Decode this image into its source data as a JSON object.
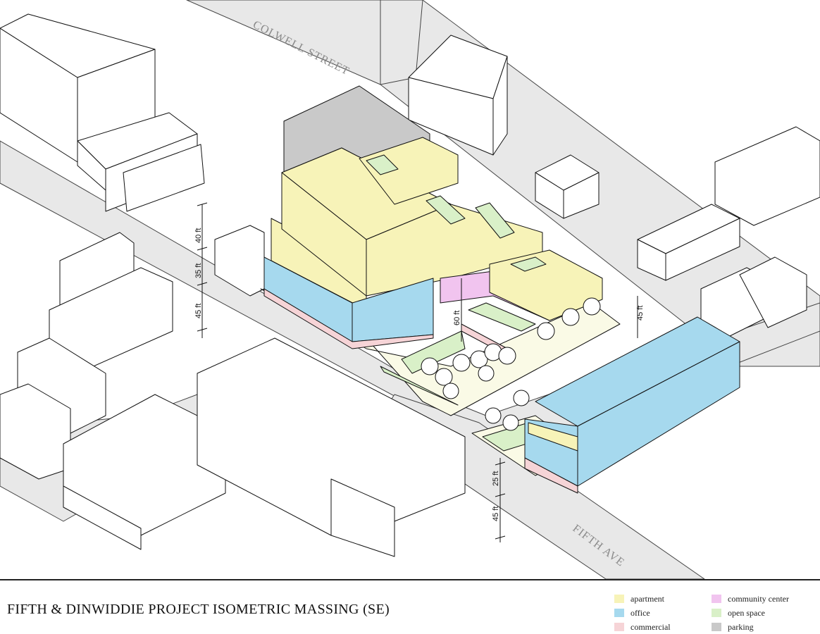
{
  "title": "FIFTH & DINWIDDIE PROJECT ISOMETRIC MASSING (SE)",
  "streets": {
    "colwell": "COLWELL STREET",
    "fifth": "FIFTH AVE"
  },
  "dimensions": {
    "left_top": "40 ft",
    "left_mid": "35 ft",
    "left_bottom": "45 ft",
    "courtyard": "60 ft",
    "right_tower": "45 ft",
    "south_upper": "25 ft",
    "south_lower": "45 ft"
  },
  "colors": {
    "apartment": "#f7f3b8",
    "office": "#a6d9ee",
    "commercial": "#f6d4d7",
    "community_center": "#f1c4ef",
    "open_space": "#d9f0c8",
    "parking": "#c9c9c9",
    "line": "#111111",
    "street_fill": "#e8e8e8"
  },
  "legend": [
    {
      "label": "apartment",
      "color": "#f7f3b8"
    },
    {
      "label": "office",
      "color": "#a6d9ee"
    },
    {
      "label": "commercial",
      "color": "#f6d4d7"
    },
    {
      "label": "community center",
      "color": "#f1c4ef"
    },
    {
      "label": "open space",
      "color": "#d9f0c8"
    },
    {
      "label": "parking",
      "color": "#c9c9c9"
    }
  ]
}
